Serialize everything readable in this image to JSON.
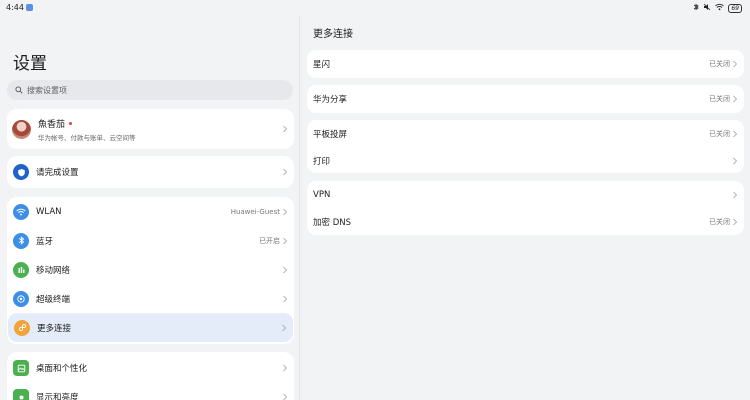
{
  "status": {
    "time": "4:44",
    "battery": "69"
  },
  "left": {
    "title": "设置",
    "search_placeholder": "搜索设置项",
    "account": {
      "name": "魚香茄",
      "subtitle": "华为帐号、付款与账单、云空间等"
    },
    "setup": {
      "label": "请完成设置"
    },
    "network": [
      {
        "label": "WLAN",
        "value": "Huawei-Guest"
      },
      {
        "label": "蓝牙",
        "value": "已开启"
      },
      {
        "label": "移动网络",
        "value": ""
      },
      {
        "label": "超级终端",
        "value": ""
      },
      {
        "label": "更多连接",
        "value": ""
      }
    ],
    "display": [
      {
        "label": "桌面和个性化"
      },
      {
        "label": "显示和亮度"
      }
    ]
  },
  "right": {
    "title": "更多连接",
    "groups": [
      [
        {
          "label": "星闪",
          "value": "已关闭"
        }
      ],
      [
        {
          "label": "华为分享",
          "value": "已关闭"
        }
      ],
      [
        {
          "label": "平板投屏",
          "value": "已关闭"
        },
        {
          "label": "打印",
          "value": ""
        }
      ],
      [
        {
          "label": "VPN",
          "value": ""
        },
        {
          "label": "加密 DNS",
          "value": "已关闭"
        }
      ]
    ]
  },
  "colors": {
    "accent": "#2e6cdf",
    "wlan_icon": "#3d8ee6",
    "bluetooth_icon": "#3d8ee6",
    "mobile_icon": "#4caf50",
    "terminal_icon": "#3d8ee6",
    "more_icon": "#f2a33a",
    "desktop_icon": "#4caf50",
    "setup_icon": "#1e63c9"
  }
}
